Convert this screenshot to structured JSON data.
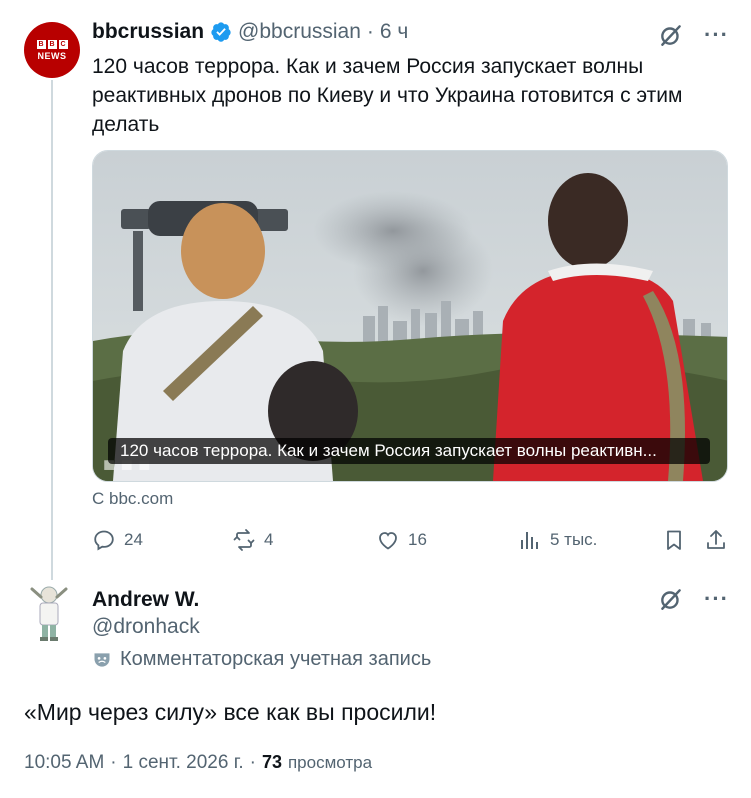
{
  "tweet": {
    "avatar_text_top": "BBC",
    "avatar_text_bottom": "NEWS",
    "display_name": "bbcrussian",
    "handle": "@bbcrussian",
    "separator": "·",
    "time": "6 ч",
    "text": "120 часов террора. Как и зачем Россия запускает волны реактивных дронов по Киеву и что Украина готовится с этим делать",
    "media_caption": "120 часов террора. Как и зачем Россия запускает волны реактивн...",
    "source": "С bbc.com",
    "replies": "24",
    "reposts": "4",
    "likes": "16",
    "views": "5 тыс."
  },
  "reply": {
    "display_name": "Andrew W.",
    "handle": "@dronhack",
    "badge": "Комментаторская учетная запись",
    "text": "«Мир через силу» все как вы просили!",
    "time": "10:05 AM",
    "dot": "·",
    "date": "1 сент. 2026 г.",
    "dot2": "·",
    "views_count": "73",
    "views_label": "просмотра"
  },
  "icons": {
    "verified": "verified-badge-icon",
    "grok": "grok-icon",
    "more": "more-icon",
    "reply": "reply-icon",
    "repost": "repost-icon",
    "like": "like-icon",
    "views": "views-icon",
    "bookmark": "bookmark-icon",
    "share": "share-icon",
    "mask": "mask-icon"
  },
  "colors": {
    "bbc_red": "#b80000",
    "verified_blue": "#1d9bf0",
    "secondary_text": "#536471"
  }
}
